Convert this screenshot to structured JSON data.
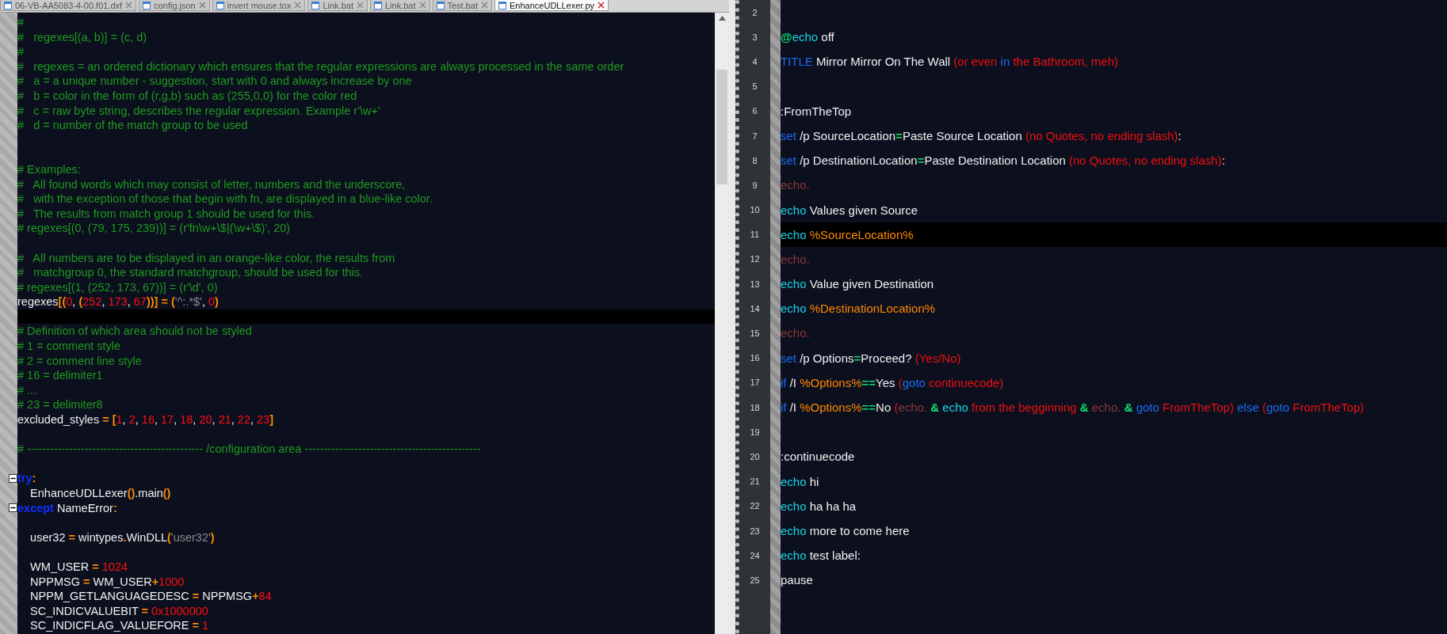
{
  "tabs": [
    {
      "label": "06-VB-AA5083-4-00.f01.dxf",
      "selected": false
    },
    {
      "label": "config.json",
      "selected": false
    },
    {
      "label": "invert mouse.tox",
      "selected": false
    },
    {
      "label": "Link.bat",
      "selected": false
    },
    {
      "label": "Link.bat",
      "selected": false
    },
    {
      "label": "Test.bat",
      "selected": false
    },
    {
      "label": "EnhanceUDLLexer.py",
      "selected": true
    }
  ],
  "left_editor": {
    "lines": [
      {
        "segments": [
          {
            "text": "#",
            "kind": "comment"
          }
        ]
      },
      {
        "segments": [
          {
            "text": "#   regexes[(a, b)] = (c, d)",
            "kind": "comment"
          }
        ]
      },
      {
        "segments": [
          {
            "text": "#",
            "kind": "comment"
          }
        ]
      },
      {
        "segments": [
          {
            "text": "#   regexes = an ordered dictionary which ensures that the regular expressions are always processed in the same order",
            "kind": "comment"
          }
        ]
      },
      {
        "segments": [
          {
            "text": "#   a = a unique number - suggestion, start with 0 and always increase by one",
            "kind": "comment"
          }
        ]
      },
      {
        "segments": [
          {
            "text": "#   b = color in the form of (r,g,b) such as (255,0,0) for the color red",
            "kind": "comment"
          }
        ]
      },
      {
        "segments": [
          {
            "text": "#   c = raw byte string, describes the regular expression. Example r'\\w+'",
            "kind": "comment"
          }
        ]
      },
      {
        "segments": [
          {
            "text": "#   d = number of the match group to be used",
            "kind": "comment"
          }
        ]
      },
      {
        "kind": "blank"
      },
      {
        "kind": "blank"
      },
      {
        "segments": [
          {
            "text": "# Examples:",
            "kind": "comment"
          }
        ]
      },
      {
        "segments": [
          {
            "text": "#   All found words which may consist of letter, numbers and the underscore,",
            "kind": "comment"
          }
        ]
      },
      {
        "segments": [
          {
            "text": "#   with the exception of those that begin with fn, are displayed in a blue-like color.",
            "kind": "comment"
          }
        ]
      },
      {
        "segments": [
          {
            "text": "#   The results from match group 1 should be used for this.",
            "kind": "comment"
          }
        ]
      },
      {
        "segments": [
          {
            "text": "# regexes[(0, (79, 175, 239))] = (r'fn\\w+\\$|(\\w+\\$)', 20)",
            "kind": "comment"
          }
        ]
      },
      {
        "kind": "blank"
      },
      {
        "segments": [
          {
            "text": "#   All numbers are to be displayed in an orange-like color, the results from",
            "kind": "comment"
          }
        ]
      },
      {
        "segments": [
          {
            "text": "#   matchgroup 0, the standard matchgroup, should be used for this.",
            "kind": "comment"
          }
        ]
      },
      {
        "segments": [
          {
            "text": "# regexes[(1, (252, 173, 67))] = (r'\\d', 0)",
            "kind": "comment"
          }
        ]
      },
      {
        "segments": [
          {
            "text": "regexes",
            "kind": "text"
          },
          {
            "text": "[(",
            "kind": "operator"
          },
          {
            "text": "0",
            "kind": "number"
          },
          {
            "text": ", ",
            "kind": "text"
          },
          {
            "text": "(",
            "kind": "operator"
          },
          {
            "text": "252",
            "kind": "number"
          },
          {
            "text": ", ",
            "kind": "text"
          },
          {
            "text": "173",
            "kind": "number"
          },
          {
            "text": ", ",
            "kind": "text"
          },
          {
            "text": "67",
            "kind": "number"
          },
          {
            "text": "))] = (",
            "kind": "operator"
          },
          {
            "text": "'^:.*$'",
            "kind": "string"
          },
          {
            "text": ", ",
            "kind": "text"
          },
          {
            "text": "0",
            "kind": "number"
          },
          {
            "text": ")",
            "kind": "operator"
          }
        ]
      },
      {
        "current": true
      },
      {
        "segments": [
          {
            "text": "# Definition of which area should not be styled",
            "kind": "comment"
          }
        ]
      },
      {
        "segments": [
          {
            "text": "# 1 = comment style",
            "kind": "comment"
          }
        ]
      },
      {
        "segments": [
          {
            "text": "# 2 = comment line style",
            "kind": "comment"
          }
        ]
      },
      {
        "segments": [
          {
            "text": "# 16 = delimiter1",
            "kind": "comment"
          }
        ]
      },
      {
        "segments": [
          {
            "text": "# ...",
            "kind": "comment"
          }
        ]
      },
      {
        "segments": [
          {
            "text": "# 23 = delimiter8",
            "kind": "comment"
          }
        ]
      },
      {
        "segments": [
          {
            "text": "excluded_styles ",
            "kind": "text"
          },
          {
            "text": "= [",
            "kind": "operator"
          },
          {
            "text": "1",
            "kind": "number"
          },
          {
            "text": ", ",
            "kind": "text"
          },
          {
            "text": "2",
            "kind": "number"
          },
          {
            "text": ", ",
            "kind": "text"
          },
          {
            "text": "16",
            "kind": "number"
          },
          {
            "text": ", ",
            "kind": "text"
          },
          {
            "text": "17",
            "kind": "number"
          },
          {
            "text": ", ",
            "kind": "text"
          },
          {
            "text": "18",
            "kind": "number"
          },
          {
            "text": ", ",
            "kind": "text"
          },
          {
            "text": "20",
            "kind": "number"
          },
          {
            "text": ", ",
            "kind": "text"
          },
          {
            "text": "21",
            "kind": "number"
          },
          {
            "text": ", ",
            "kind": "text"
          },
          {
            "text": "22",
            "kind": "number"
          },
          {
            "text": ", ",
            "kind": "text"
          },
          {
            "text": "23",
            "kind": "number"
          },
          {
            "text": "]",
            "kind": "operator"
          }
        ]
      },
      {
        "kind": "blank"
      },
      {
        "segments": [
          {
            "text": "# ---------------------------------------------- /configuration area ----------------------------------------------",
            "kind": "comment"
          }
        ]
      },
      {
        "kind": "blank"
      },
      {
        "segments": [
          {
            "text": "try",
            "kind": "keyword"
          },
          {
            "text": ":",
            "kind": "operator"
          }
        ],
        "fold": true
      },
      {
        "segments": [
          {
            "text": "    EnhanceUDLLexer",
            "kind": "text"
          },
          {
            "text": "()",
            "kind": "operator"
          },
          {
            "text": ".main",
            "kind": "text"
          },
          {
            "text": "()",
            "kind": "operator"
          }
        ]
      },
      {
        "segments": [
          {
            "text": "except",
            "kind": "keyword"
          },
          {
            "text": " NameError",
            "kind": "text"
          },
          {
            "text": ":",
            "kind": "operator"
          }
        ],
        "fold": true
      },
      {
        "kind": "blank"
      },
      {
        "segments": [
          {
            "text": "    user32 ",
            "kind": "text"
          },
          {
            "text": "=",
            "kind": "operator"
          },
          {
            "text": " wintypes",
            "kind": "text"
          },
          {
            "text": ".",
            "kind": "operator"
          },
          {
            "text": "WinDLL",
            "kind": "text"
          },
          {
            "text": "(",
            "kind": "operator"
          },
          {
            "text": "'user32'",
            "kind": "string"
          },
          {
            "text": ")",
            "kind": "operator"
          }
        ]
      },
      {
        "kind": "blank"
      },
      {
        "segments": [
          {
            "text": "    WM_USER ",
            "kind": "text"
          },
          {
            "text": "=",
            "kind": "operator"
          },
          {
            "text": " 1024",
            "kind": "number"
          }
        ]
      },
      {
        "segments": [
          {
            "text": "    NPPMSG ",
            "kind": "text"
          },
          {
            "text": "=",
            "kind": "operator"
          },
          {
            "text": " WM_USER",
            "kind": "text"
          },
          {
            "text": "+",
            "kind": "operator"
          },
          {
            "text": "1000",
            "kind": "number"
          }
        ]
      },
      {
        "segments": [
          {
            "text": "    NPPM_GETLANGUAGEDESC ",
            "kind": "text"
          },
          {
            "text": "=",
            "kind": "operator"
          },
          {
            "text": " NPPMSG",
            "kind": "text"
          },
          {
            "text": "+",
            "kind": "operator"
          },
          {
            "text": "84",
            "kind": "number"
          }
        ]
      },
      {
        "segments": [
          {
            "text": "    SC_INDICVALUEBIT ",
            "kind": "text"
          },
          {
            "text": "=",
            "kind": "operator"
          },
          {
            "text": " 0x1000000",
            "kind": "number"
          }
        ]
      },
      {
        "segments": [
          {
            "text": "    SC_INDICFLAG_VALUEFORE ",
            "kind": "text"
          },
          {
            "text": "=",
            "kind": "operator"
          },
          {
            "text": " 1",
            "kind": "number"
          }
        ]
      }
    ]
  },
  "right_editor": {
    "lines": [
      {
        "number": "2",
        "kind": "blank"
      },
      {
        "number": "3",
        "segments": [
          {
            "text": "@",
            "kind": "operator"
          },
          {
            "text": "echo",
            "kind": "command"
          },
          {
            "text": " off",
            "kind": "text"
          }
        ]
      },
      {
        "number": "4",
        "segments": [
          {
            "text": "TITLE",
            "kind": "keyword"
          },
          {
            "text": " Mirror Mirror On The Wall ",
            "kind": "text"
          },
          {
            "text": "(or even ",
            "kind": "group"
          },
          {
            "text": "in",
            "kind": "keyword"
          },
          {
            "text": " the Bathroom, meh)",
            "kind": "group"
          }
        ]
      },
      {
        "number": "5",
        "kind": "blank"
      },
      {
        "number": "6",
        "segments": [
          {
            "text": ":FromTheTop",
            "kind": "text"
          }
        ]
      },
      {
        "number": "7",
        "segments": [
          {
            "text": "set",
            "kind": "keyword"
          },
          {
            "text": " /p SourceLocation",
            "kind": "text"
          },
          {
            "text": "=",
            "kind": "operator"
          },
          {
            "text": "Paste Source Location ",
            "kind": "text"
          },
          {
            "text": "(no Quotes, no ending slash)",
            "kind": "group"
          },
          {
            "text": ":",
            "kind": "text"
          }
        ]
      },
      {
        "number": "8",
        "segments": [
          {
            "text": "set",
            "kind": "keyword"
          },
          {
            "text": " /p DestinationLocation",
            "kind": "text"
          },
          {
            "text": "=",
            "kind": "operator"
          },
          {
            "text": "Paste Destination Location ",
            "kind": "text"
          },
          {
            "text": "(no Quotes, no ending slash)",
            "kind": "group"
          },
          {
            "text": ":",
            "kind": "text"
          }
        ]
      },
      {
        "number": "9",
        "segments": [
          {
            "text": "echo.",
            "kind": "dim"
          }
        ]
      },
      {
        "number": "10",
        "segments": [
          {
            "text": "echo",
            "kind": "command"
          },
          {
            "text": " Values given Source",
            "kind": "text"
          }
        ]
      },
      {
        "number": "11",
        "segments": [
          {
            "text": "echo",
            "kind": "command"
          },
          {
            "text": " %SourceLocation%",
            "kind": "variable"
          }
        ],
        "current": true
      },
      {
        "number": "12",
        "segments": [
          {
            "text": "echo.",
            "kind": "dim"
          }
        ]
      },
      {
        "number": "13",
        "segments": [
          {
            "text": "echo",
            "kind": "command"
          },
          {
            "text": " Value given Destination",
            "kind": "text"
          }
        ]
      },
      {
        "number": "14",
        "segments": [
          {
            "text": "echo",
            "kind": "command"
          },
          {
            "text": " %DestinationLocation%",
            "kind": "variable"
          }
        ]
      },
      {
        "number": "15",
        "segments": [
          {
            "text": "echo.",
            "kind": "dim"
          }
        ]
      },
      {
        "number": "16",
        "segments": [
          {
            "text": "set",
            "kind": "keyword"
          },
          {
            "text": " /p Options",
            "kind": "text"
          },
          {
            "text": "=",
            "kind": "operator"
          },
          {
            "text": "Proceed? ",
            "kind": "text"
          },
          {
            "text": "(Yes/No)",
            "kind": "group"
          }
        ]
      },
      {
        "number": "17",
        "segments": [
          {
            "text": "if",
            "kind": "keyword"
          },
          {
            "text": " /I ",
            "kind": "text"
          },
          {
            "text": "%Options%",
            "kind": "variable"
          },
          {
            "text": "==",
            "kind": "operator"
          },
          {
            "text": "Yes ",
            "kind": "text"
          },
          {
            "text": "(",
            "kind": "group"
          },
          {
            "text": "goto",
            "kind": "keyword"
          },
          {
            "text": " continuecode)",
            "kind": "group"
          }
        ]
      },
      {
        "number": "18",
        "segments": [
          {
            "text": "if",
            "kind": "keyword"
          },
          {
            "text": " /I ",
            "kind": "text"
          },
          {
            "text": "%Options%",
            "kind": "variable"
          },
          {
            "text": "==",
            "kind": "operator"
          },
          {
            "text": "No ",
            "kind": "text"
          },
          {
            "text": "(",
            "kind": "group"
          },
          {
            "text": "echo. ",
            "kind": "dim"
          },
          {
            "text": "& ",
            "kind": "operator"
          },
          {
            "text": "echo",
            "kind": "command"
          },
          {
            "text": " from the begginning ",
            "kind": "group"
          },
          {
            "text": "& ",
            "kind": "operator"
          },
          {
            "text": "echo. ",
            "kind": "dim"
          },
          {
            "text": "& ",
            "kind": "operator"
          },
          {
            "text": "goto",
            "kind": "keyword"
          },
          {
            "text": " FromTheTop)",
            "kind": "group"
          },
          {
            "text": " else ",
            "kind": "keyword"
          },
          {
            "text": "(",
            "kind": "group"
          },
          {
            "text": "goto",
            "kind": "keyword"
          },
          {
            "text": " FromTheTop)",
            "kind": "group"
          }
        ]
      },
      {
        "number": "19",
        "kind": "blank"
      },
      {
        "number": "20",
        "segments": [
          {
            "text": ":continuecode",
            "kind": "text"
          }
        ]
      },
      {
        "number": "21",
        "segments": [
          {
            "text": "echo",
            "kind": "command"
          },
          {
            "text": " hi",
            "kind": "text"
          }
        ]
      },
      {
        "number": "22",
        "segments": [
          {
            "text": "echo",
            "kind": "command"
          },
          {
            "text": " ha ha ha",
            "kind": "text"
          }
        ]
      },
      {
        "number": "23",
        "segments": [
          {
            "text": "echo",
            "kind": "command"
          },
          {
            "text": " more to come here",
            "kind": "text"
          }
        ]
      },
      {
        "number": "24",
        "segments": [
          {
            "text": "echo",
            "kind": "command"
          },
          {
            "text": " test label:",
            "kind": "text"
          }
        ]
      },
      {
        "number": "25",
        "segments": [
          {
            "text": "pause",
            "kind": "text"
          }
        ]
      }
    ]
  }
}
